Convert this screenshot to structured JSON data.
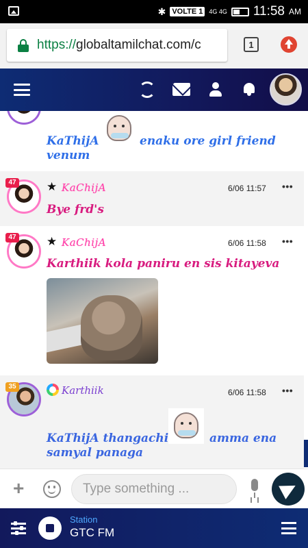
{
  "status_bar": {
    "network": "VOLTE 1",
    "signal": "4G 4G",
    "time": "11:58",
    "ampm": "AM"
  },
  "browser": {
    "url_scheme": "https://",
    "url_host": "globaltamilchat.com/c",
    "tab_count": "1"
  },
  "app_bar": {
    "icons": [
      "menu-icon",
      "refresh-icon",
      "mail-icon",
      "user-icon",
      "bell-icon"
    ]
  },
  "messages": [
    {
      "user": "",
      "text_before": "KaThijA",
      "text_after": "enaku ore girl friend",
      "text_line2": "venum",
      "has_sticker": true
    },
    {
      "user": "KaChijA",
      "badge": "47",
      "time": "6/06 11:57",
      "text": "Bye frd's"
    },
    {
      "user": "KaChijA",
      "badge": "47",
      "time": "6/06 11:58",
      "text": "Karthiik kola paniru en sis kitayeva",
      "has_gif": true
    },
    {
      "user": "Karthiik",
      "badge": "35",
      "time": "6/06 11:58",
      "text_before": "KaThijA thangachi",
      "text_after": "amma ena",
      "text_line2": "samyal panaga",
      "has_sticker": true
    }
  ],
  "more_label": "•••",
  "composer": {
    "placeholder": "Type something ...",
    "plus_label": "+"
  },
  "player": {
    "station_label": "Station",
    "station_name": "GTC FM"
  },
  "colors": {
    "primary": "#12195c",
    "pink_name": "#ff3fa8",
    "blue_text": "#2f6fe8",
    "pink_text": "#d81b7f"
  }
}
